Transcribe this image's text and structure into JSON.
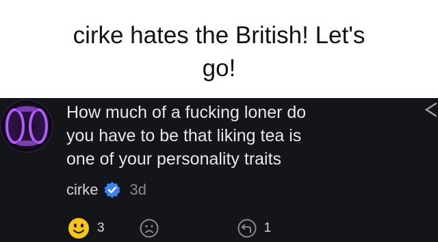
{
  "caption": {
    "line1": "cirke hates the British! Let's",
    "line2": "go!"
  },
  "comment": {
    "lines": [
      "How much of a fucking loner do",
      "you have to be that liking tea is",
      "one of your personality traits"
    ],
    "author": "cirke",
    "time": "3d"
  },
  "actions": {
    "like_count": "3",
    "reply_count": "1"
  },
  "icons": {
    "avatar": "avatar-image",
    "verified": "verified-badge-icon",
    "like": "smiley-face-icon",
    "dislike": "sad-face-icon",
    "reply": "reply-icon",
    "share": "share-icon"
  },
  "colors": {
    "card_background": "#141519",
    "verified_blue": "#3b82f6",
    "smiley_yellow": "#f5c518"
  }
}
